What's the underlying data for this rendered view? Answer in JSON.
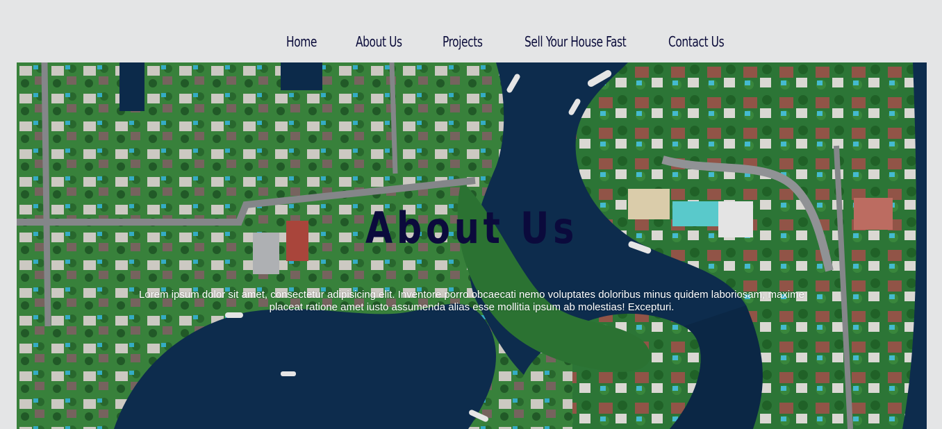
{
  "nav": {
    "items": [
      {
        "label": "Home"
      },
      {
        "label": "About Us"
      },
      {
        "label": "Projects"
      },
      {
        "label": "Sell Your House Fast"
      },
      {
        "label": "Contact Us"
      }
    ]
  },
  "hero": {
    "title": "About Us",
    "body": "Lorem ipsum dolor sit amet, consectetur adipisicing elit. Inventore porro obcaecati nemo voluptates doloribus minus quidem laboriosam, maxime placeat ratione amet iusto assumenda alias esse mollitia ipsum ab molestias! Excepturi."
  },
  "colors": {
    "page_background": "#e4e5e6",
    "nav_text": "#0b0c3a",
    "title_text": "#0b0a3c",
    "water": "#0d2d4f",
    "vegetation": "#2f7d3a"
  }
}
